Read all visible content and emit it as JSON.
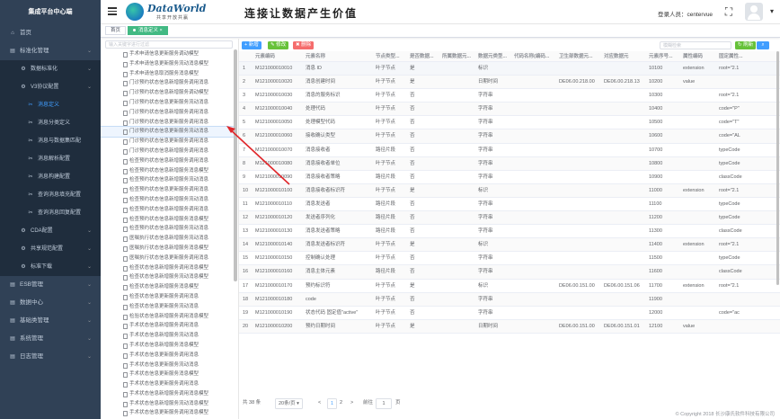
{
  "sidebar": {
    "brand": "集成平台中心端",
    "items": [
      {
        "label": "首页",
        "icon": "home-icon",
        "level": 1,
        "chev": false
      },
      {
        "label": "标准化管理",
        "icon": "list-icon",
        "level": 1,
        "chev": true
      },
      {
        "label": "数据标准化",
        "icon": "gear-icon",
        "level": 2,
        "chev": true
      },
      {
        "label": "V3协议配置",
        "icon": "gear-icon",
        "level": 2,
        "chev": true
      },
      {
        "label": "消息定义",
        "icon": "tool-icon",
        "level": 3,
        "active": true
      },
      {
        "label": "消息分类定义",
        "icon": "tool-icon",
        "level": 3
      },
      {
        "label": "消息与数据集匹配",
        "icon": "tool-icon",
        "level": 3
      },
      {
        "label": "消息解析配置",
        "icon": "tool-icon",
        "level": 3
      },
      {
        "label": "消息构建配置",
        "icon": "tool-icon",
        "level": 3
      },
      {
        "label": "查询消息填充配置",
        "icon": "tool-icon",
        "level": 3
      },
      {
        "label": "查询消息回复配置",
        "icon": "tool-icon",
        "level": 3
      },
      {
        "label": "CDA配置",
        "icon": "gear-icon",
        "level": 2,
        "chev": true
      },
      {
        "label": "共享规范配置",
        "icon": "gear-icon",
        "level": 2,
        "chev": true
      },
      {
        "label": "标准下载",
        "icon": "gear-icon",
        "level": 2,
        "chev": true
      },
      {
        "label": "ESB管理",
        "icon": "list-icon",
        "level": 1,
        "chev": true
      },
      {
        "label": "数据中心",
        "icon": "list-icon",
        "level": 1,
        "chev": true
      },
      {
        "label": "基础类管理",
        "icon": "list-icon",
        "level": 1,
        "chev": true
      },
      {
        "label": "系统管理",
        "icon": "list-icon",
        "level": 1,
        "chev": true
      },
      {
        "label": "日志管理",
        "icon": "list-icon",
        "level": 1,
        "chev": true
      }
    ]
  },
  "topbar": {
    "logo_text": "DataWorld",
    "logo_sub": "共享开放共赢",
    "slogan": "连接让数据产生价值",
    "login_label": "登录人员：",
    "login_user": "centervue"
  },
  "tags": {
    "home": "首页",
    "active": "消息定义"
  },
  "tree": {
    "placeholder": "输入关键字进行过滤",
    "nodes": [
      "手术申请信息更新服务调动模型",
      "手术申请信息更新服务流动消息模型",
      "手术申请信息取消服务消息模型",
      "门诊预约状态信息新增服务调用消息",
      "门诊预约状态信息新增服务调动模型",
      "门诊预约状态信息更新服务流动消息",
      "门诊预约状态信息新增服务调用消息",
      "门诊预约状态信息更新服务调用消息",
      "门诊预约状态信息更新服务流动消息",
      "门诊预约状态信息更新服务调用消息",
      "门诊预约状态信息新增服务调用消息",
      "检查预约状态信息新增服务调用消息",
      "检查预约状态信息新增服务消息模型",
      "检查预约状态信息新增服务流动消息",
      "检查预约状态信息更新服务调用消息",
      "检查预约状态信息新增服务流动消息",
      "检查预约状态信息新增服务调用消息",
      "检查预约状态信息新增服务消息模型",
      "检查预约状态信息新增服务流动消息",
      "医嘱执行状态信息新增服务流动消息",
      "医嘱执行状态信息新增服务消息模型",
      "医嘱执行状态信息更新服务调用消息",
      "检查状态信息新增服务调用消息模型",
      "检查状态信息新增服务流动消息模型",
      "检查状态信息新增服务消息模型",
      "检查状态信息更新服务调用消息",
      "检查状态信息更新服务流动消息",
      "检验状态信息新增服务调用消息模型",
      "手术状态信息新增服务调用消息",
      "手术状态信息新增服务流动消息",
      "手术状态信息新增服务消息模型",
      "手术状态信息更新服务调用消息",
      "手术状态信息更新服务流动消息",
      "手术状态信息更新服务消息模型",
      "手术状态信息更新服务调用消息",
      "手术状态信息新增服务调用消息模型",
      "手术状态信息新增服务流动消息模型",
      "手术状态信息更新服务调用消息模型",
      "手术状态信息更新服务流动消息模型"
    ]
  },
  "toolbar": {
    "add": "+ 新增",
    "edit": "✎ 修改",
    "del": "✖ 删除",
    "search_placeholder": "模糊检索",
    "refresh": "↻ 刷新",
    "search": "⌕"
  },
  "table": {
    "headers": [
      "",
      "元素编码",
      "元素名称",
      "节点类型...",
      "是否数据...",
      "所属数据元...",
      "数据元类型...",
      "代码名称(编码...",
      "卫生部数据元...",
      "对应数据元",
      "元素序号...",
      "属性编码",
      "固定属性..."
    ],
    "rows": [
      [
        "1",
        "M121000010010",
        "消息 ID",
        "叶子节点",
        "是",
        "",
        "标识",
        "",
        "",
        "",
        "10100",
        "extension",
        "root=\"2.1"
      ],
      [
        "2",
        "M121000010020",
        "消息创建时间",
        "叶子节点",
        "是",
        "",
        "日期时间",
        "",
        "DE06.00.218.00",
        "DE06.00.218.13",
        "10200",
        "value",
        ""
      ],
      [
        "3",
        "M121000010030",
        "消息的服务标识",
        "叶子节点",
        "否",
        "",
        "字符串",
        "",
        "",
        "",
        "10300",
        "",
        "root=\"2.1"
      ],
      [
        "4",
        "M121000010040",
        "处理代码",
        "叶子节点",
        "否",
        "",
        "字符串",
        "",
        "",
        "",
        "10400",
        "",
        "code=\"P\""
      ],
      [
        "5",
        "M121000010050",
        "处理模型代码",
        "叶子节点",
        "否",
        "",
        "字符串",
        "",
        "",
        "",
        "10500",
        "",
        "code=\"T\""
      ],
      [
        "6",
        "M121000010060",
        "接收确认类型",
        "叶子节点",
        "否",
        "",
        "字符串",
        "",
        "",
        "",
        "10600",
        "",
        "code=\"AL"
      ],
      [
        "7",
        "M121000010070",
        "消息接收者",
        "路径片段",
        "否",
        "",
        "字符串",
        "",
        "",
        "",
        "10700",
        "",
        "typeCode"
      ],
      [
        "8",
        "M121000010080",
        "消息接收者单位",
        "叶子节点",
        "否",
        "",
        "字符串",
        "",
        "",
        "",
        "10800",
        "",
        "typeCode"
      ],
      [
        "9",
        "M121000010090",
        "消息接收者策略",
        "路径片段",
        "否",
        "",
        "字符串",
        "",
        "",
        "",
        "10900",
        "",
        "classCode"
      ],
      [
        "10",
        "M121000010100",
        "消息接收者标识符",
        "叶子节点",
        "是",
        "",
        "标识",
        "",
        "",
        "",
        "11000",
        "extension",
        "root=\"2.1"
      ],
      [
        "11",
        "M121000010110",
        "消息发送者",
        "路径片段",
        "否",
        "",
        "字符串",
        "",
        "",
        "",
        "11100",
        "",
        "typeCode"
      ],
      [
        "12",
        "M121000010120",
        "发送者序列化",
        "路径片段",
        "否",
        "",
        "字符串",
        "",
        "",
        "",
        "11200",
        "",
        "typeCode"
      ],
      [
        "13",
        "M121000010130",
        "消息发送者策略",
        "路径片段",
        "否",
        "",
        "字符串",
        "",
        "",
        "",
        "11300",
        "",
        "classCode"
      ],
      [
        "14",
        "M121000010140",
        "消息发送者标识符",
        "叶子节点",
        "是",
        "",
        "标识",
        "",
        "",
        "",
        "11400",
        "extension",
        "root=\"2.1"
      ],
      [
        "15",
        "M121000010150",
        "控制确认处理",
        "叶子节点",
        "否",
        "",
        "字符串",
        "",
        "",
        "",
        "11500",
        "",
        "typeCode"
      ],
      [
        "16",
        "M121000010160",
        "消息主体元素",
        "路径片段",
        "否",
        "",
        "字符串",
        "",
        "",
        "",
        "11600",
        "",
        "classCode"
      ],
      [
        "17",
        "M121000010170",
        "预约标识符",
        "叶子节点",
        "是",
        "",
        "标识",
        "",
        "DE06.00.151.00",
        "DE06.00.151.06",
        "11700",
        "extension",
        "root=\"2.1"
      ],
      [
        "18",
        "M121000010180",
        "code",
        "叶子节点",
        "否",
        "",
        "字符串",
        "",
        "",
        "",
        "11900",
        "",
        ""
      ],
      [
        "19",
        "M121000010190",
        "状态代码 固定值\"active\"",
        "叶子节点",
        "否",
        "",
        "字符串",
        "",
        "",
        "",
        "12000",
        "",
        "code=\"ac"
      ],
      [
        "20",
        "M121000010200",
        "预约日期时间",
        "叶子节点",
        "是",
        "",
        "日期时间",
        "",
        "DE06.00.151.00",
        "DE06.00.151.01",
        "12100",
        "value",
        ""
      ]
    ]
  },
  "pager": {
    "total": "共 38 条",
    "size": "20条/页",
    "prev": "<",
    "page1": "1",
    "page2": "2",
    "next": ">",
    "goto": "前往",
    "goto_val": "1",
    "page_unit": "页"
  },
  "footer": "© Copyright 2018 长沙康氏软件科技有限公司"
}
